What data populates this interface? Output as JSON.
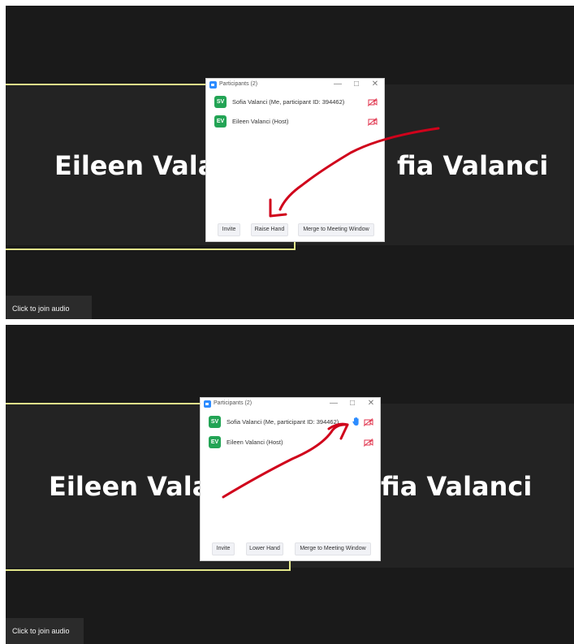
{
  "meeting": {
    "tile_names": [
      "Eileen Vala",
      "fia Valanci"
    ],
    "join_audio_label": "Click to join audio"
  },
  "participants_dialog": {
    "title": "Participants (2)",
    "window_controls": [
      "—",
      "□",
      "✕"
    ],
    "participants": [
      {
        "initials": "SV",
        "name": "Sofia Valanci (Me, participant ID: 394462)"
      },
      {
        "initials": "EV",
        "name": "Eileen Valanci (Host)"
      }
    ],
    "buttons_before": [
      "Invite",
      "Raise Hand",
      "Merge to Meeting Window"
    ],
    "buttons_after": [
      "Invite",
      "Lower Hand",
      "Merge to Meeting Window"
    ]
  },
  "colors": {
    "accent_zoom_blue": "#2d8cff",
    "avatar_green": "#23a455",
    "active_speaker_border": "#e2e68a",
    "annotation_red": "#d0021b",
    "video_off_red": "#e0334c"
  },
  "icons": [
    "zoom-logo-icon",
    "video-off-icon",
    "raised-hand-icon",
    "minimize-icon",
    "maximize-icon",
    "close-icon"
  ]
}
